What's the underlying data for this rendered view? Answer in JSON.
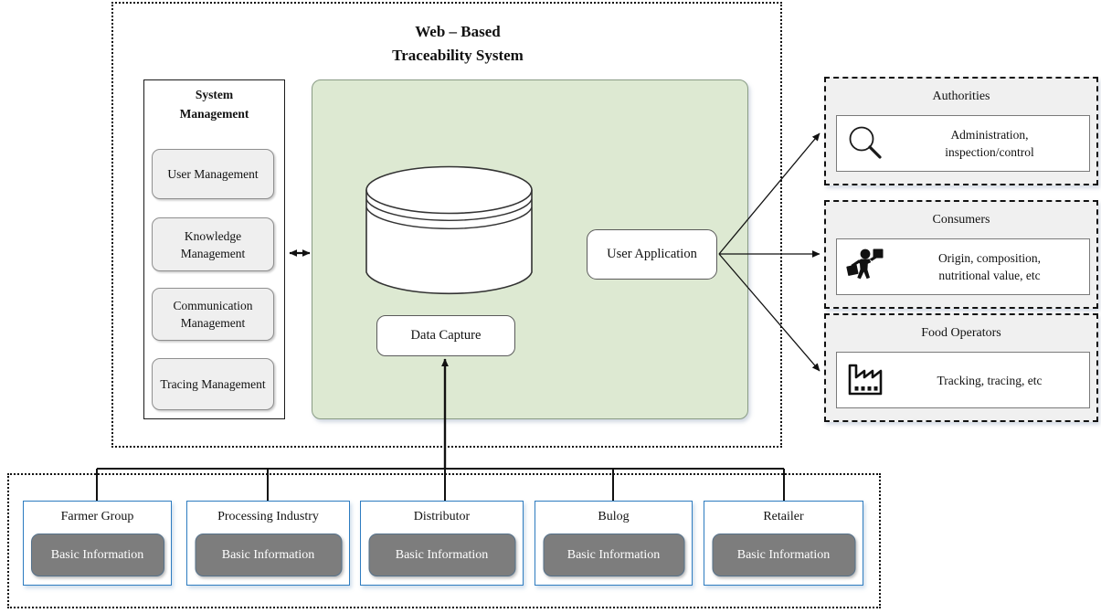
{
  "system": {
    "title_line1": "Web – Based",
    "title_line2": "Traceability System"
  },
  "system_management": {
    "title_line1": "System",
    "title_line2": "Management",
    "items": [
      {
        "label": "User Management"
      },
      {
        "label": "Knowledge Management"
      },
      {
        "label": "Communication Management"
      },
      {
        "label": "Tracing Management"
      }
    ]
  },
  "core": {
    "database_icon": "database-cylinder-icon",
    "data_capture_label": "Data Capture",
    "user_application_label": "User Application",
    "fill_color": "#dde9d2",
    "border_color": "#8a9c85"
  },
  "external_panels": [
    {
      "title": "Authorities",
      "icon": "magnifier-icon",
      "description_line1": "Administration,",
      "description_line2": "inspection/control"
    },
    {
      "title": "Consumers",
      "icon": "shopper-icon",
      "description_line1": "Origin, composition,",
      "description_line2": "nutritional value, etc"
    },
    {
      "title": "Food Operators",
      "icon": "factory-icon",
      "description_line1": "Tracking, tracing, etc",
      "description_line2": ""
    }
  ],
  "supply_chain_actors": [
    {
      "title": "Farmer Group",
      "pill_label": "Basic Information"
    },
    {
      "title": "Processing Industry",
      "pill_label": "Basic Information"
    },
    {
      "title": "Distributor",
      "pill_label": "Basic Information"
    },
    {
      "title": "Bulog",
      "pill_label": "Basic Information"
    },
    {
      "title": "Retailer",
      "pill_label": "Basic Information"
    }
  ],
  "colors": {
    "actor_border": "#2e7cc0",
    "pill_fill": "#7d7d7d",
    "panel_fill": "#f0f0f0",
    "connector": "#111111"
  }
}
